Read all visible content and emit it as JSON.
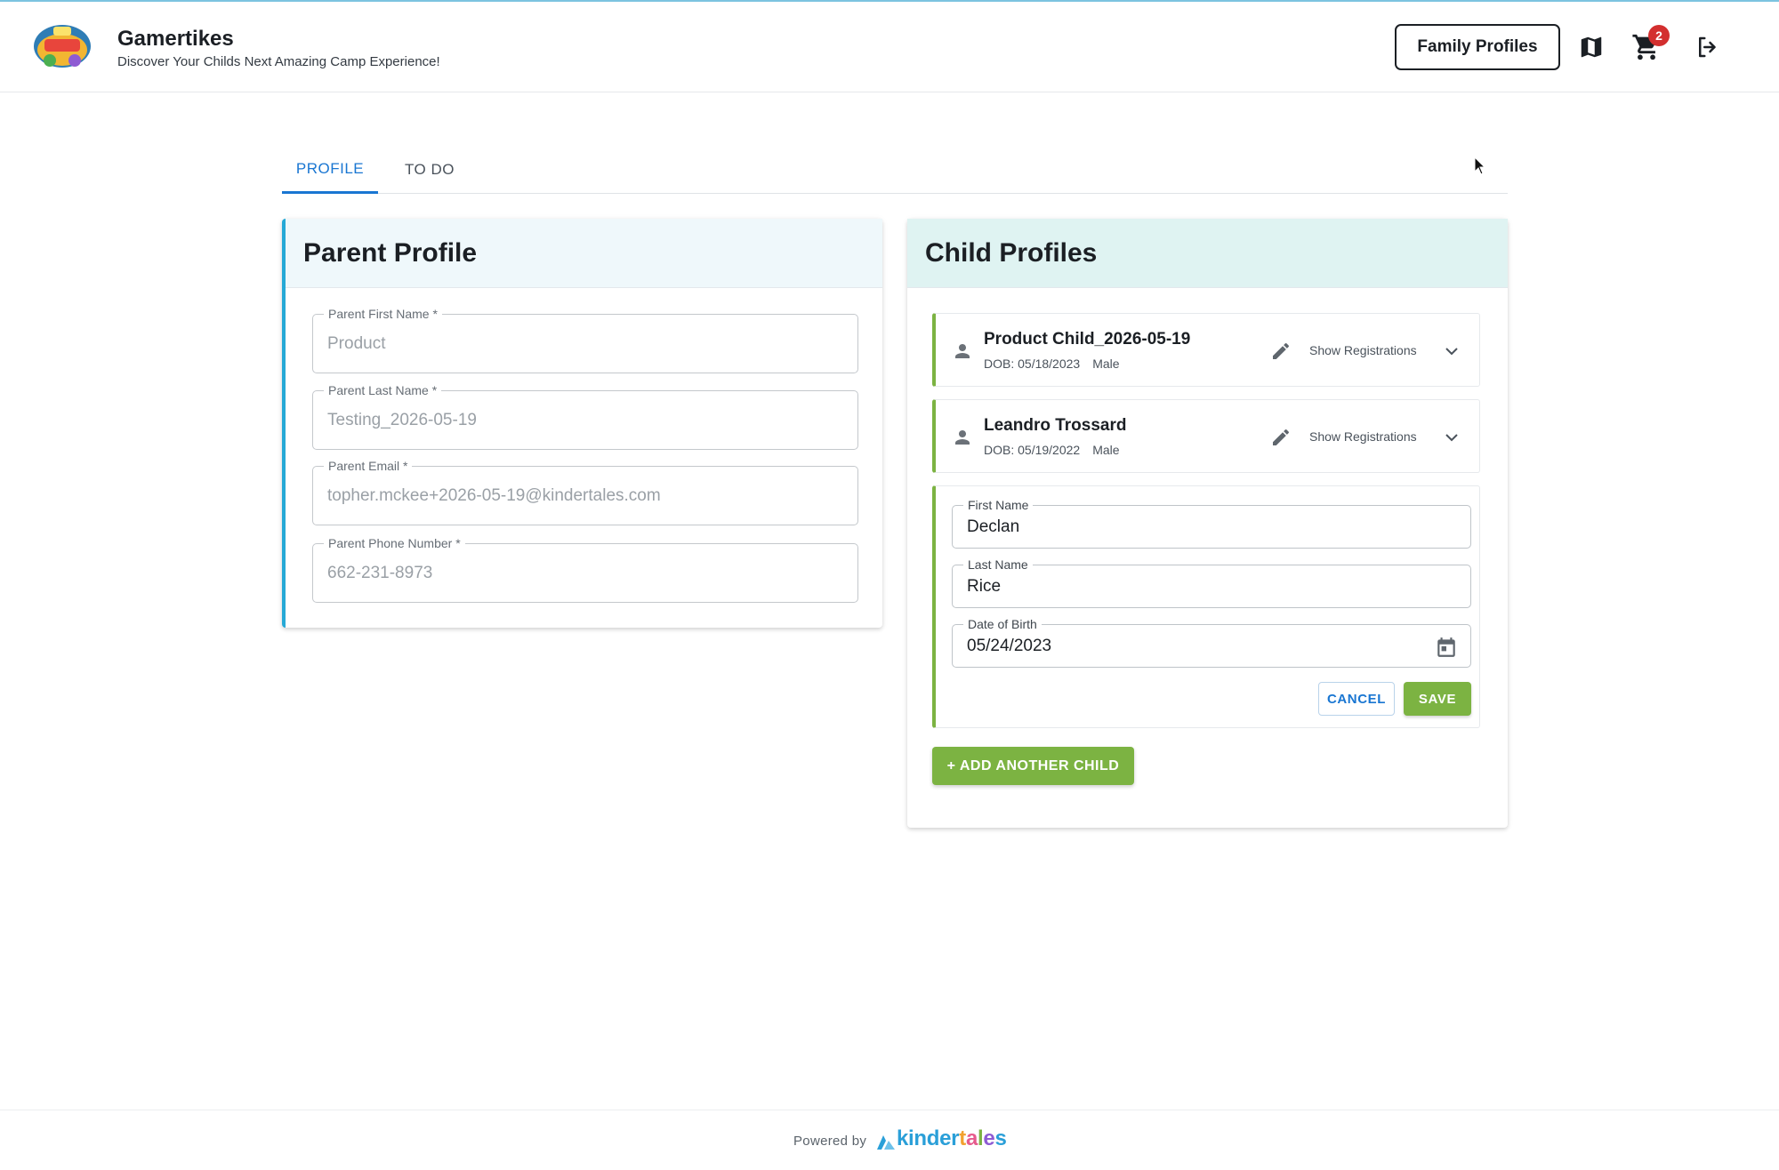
{
  "header": {
    "title": "Gamertikes",
    "tagline": "Discover Your Childs Next Amazing Camp Experience!",
    "family_profiles_label": "Family Profiles",
    "cart_count": "2",
    "icons": [
      "map-icon",
      "cart-icon",
      "logout-icon"
    ]
  },
  "tabs": [
    {
      "label": "PROFILE",
      "active": true
    },
    {
      "label": "TO DO",
      "active": false
    }
  ],
  "parent_profile": {
    "title": "Parent Profile",
    "fields": [
      {
        "label": "Parent First Name *",
        "value": "Product"
      },
      {
        "label": "Parent Last Name *",
        "value": "Testing_2026-05-19"
      },
      {
        "label": "Parent Email *",
        "value": "topher.mckee+2026-05-19@kindertales.com"
      },
      {
        "label": "Parent Phone Number *",
        "value": "662-231-8973"
      }
    ]
  },
  "child_profiles": {
    "title": "Child Profiles",
    "children": [
      {
        "name": "Product Child_2026-05-19",
        "dob": "DOB: 05/18/2023",
        "gender": "Male",
        "show_registrations": "Show Registrations"
      },
      {
        "name": "Leandro Trossard",
        "dob": "DOB: 05/19/2022",
        "gender": "Male",
        "show_registrations": "Show Registrations"
      }
    ],
    "new_child_form": {
      "first_name": {
        "label": "First Name",
        "value": "Declan"
      },
      "last_name": {
        "label": "Last Name",
        "value": "Rice"
      },
      "dob": {
        "label": "Date of Birth",
        "value": "05/24/2023"
      },
      "cancel_label": "CANCEL",
      "save_label": "SAVE"
    },
    "add_child_label": "+ ADD ANOTHER CHILD"
  },
  "footer": {
    "powered_by": "Powered by",
    "brand": "kindertales"
  },
  "colors": {
    "accent_blue": "#1976d2",
    "parent_border": "#26a9d6",
    "child_border": "#7cb342",
    "button_green": "#7cb342",
    "badge_red": "#d32f2f"
  }
}
